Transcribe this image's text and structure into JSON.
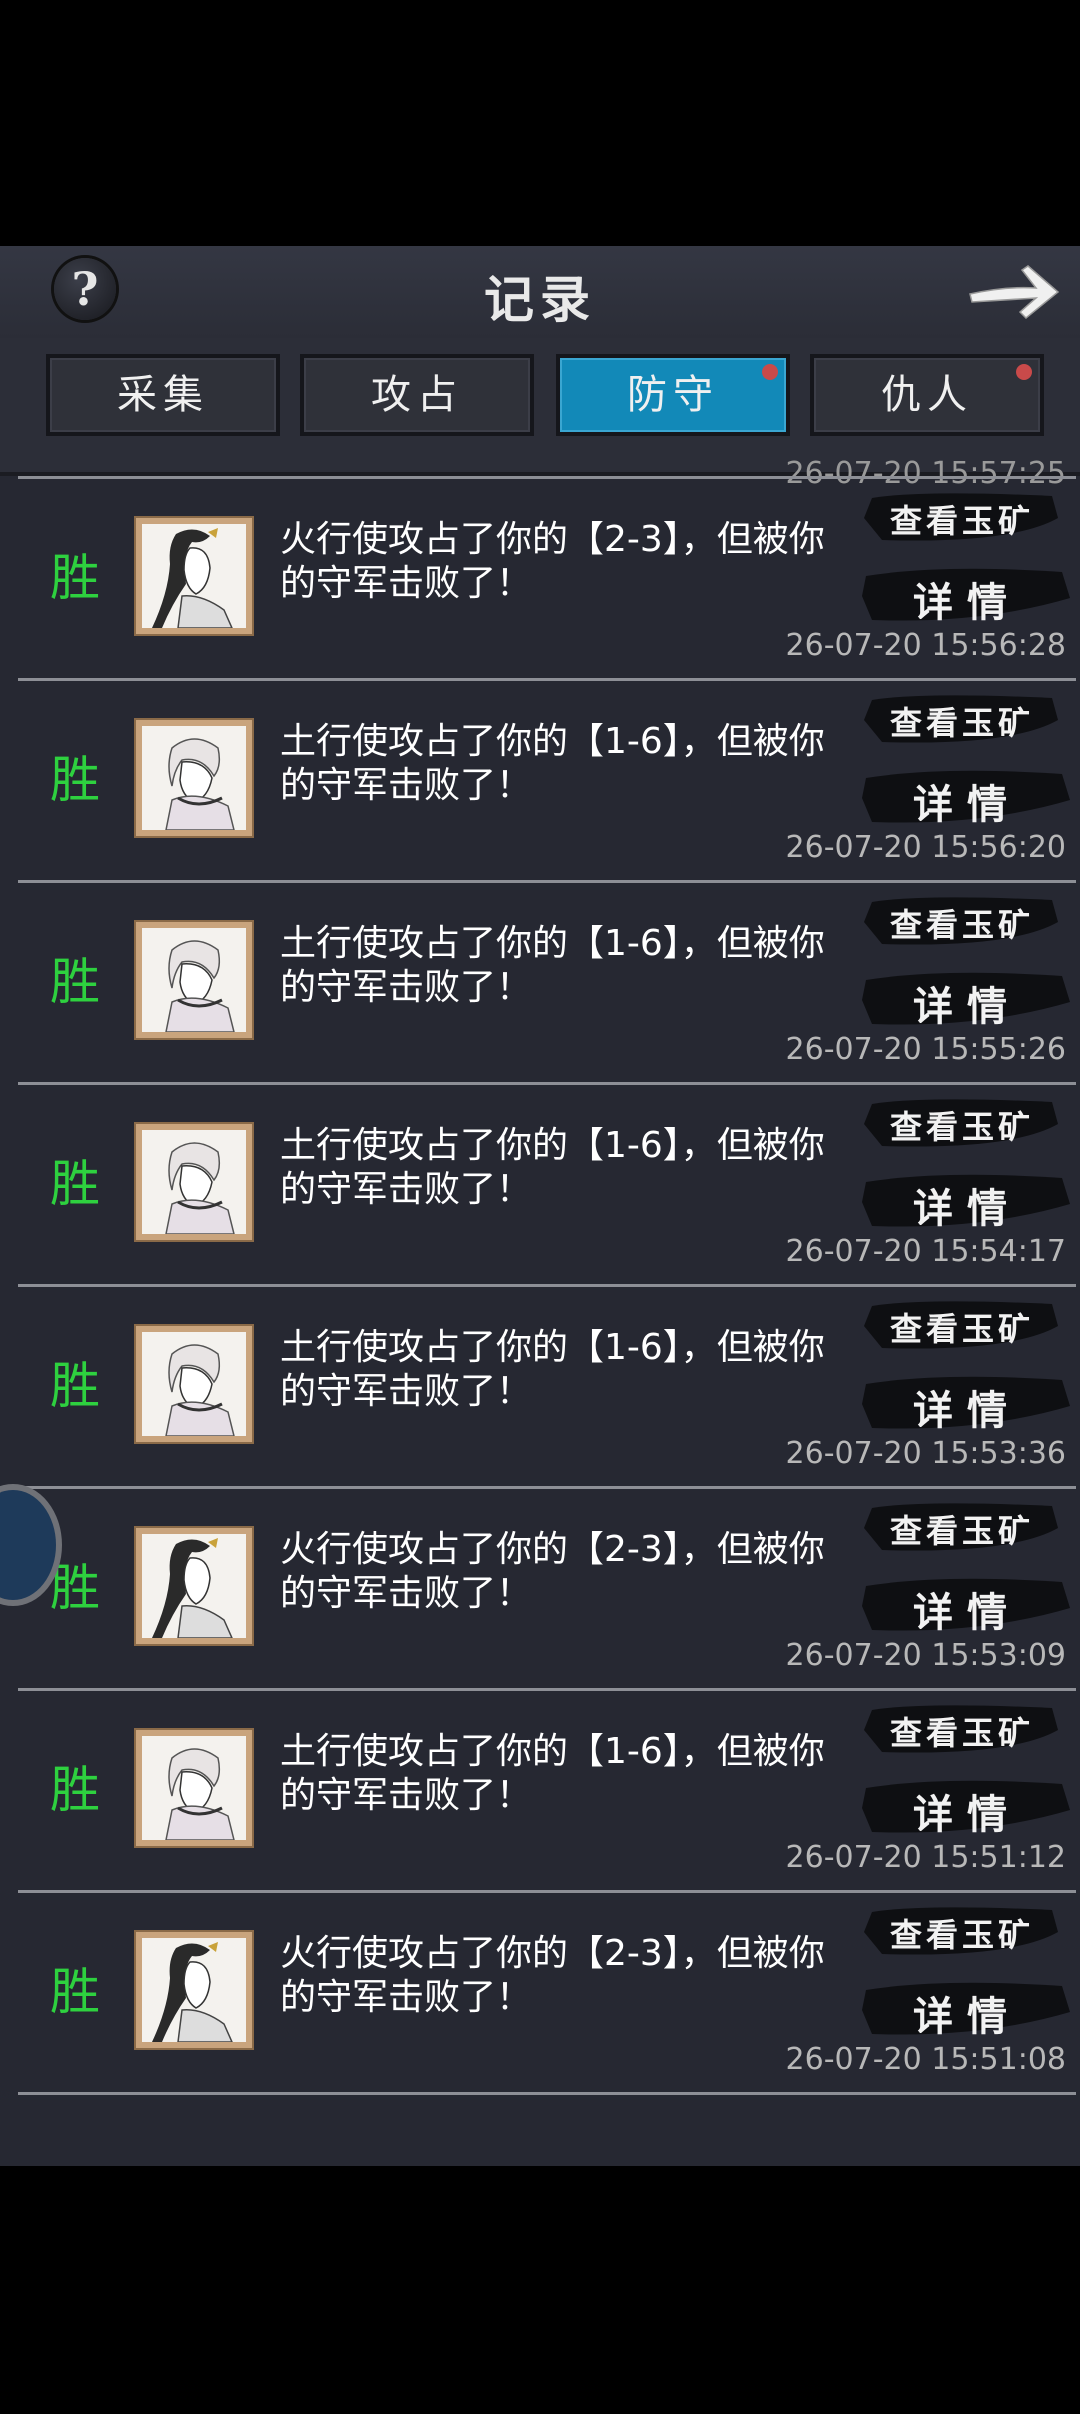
{
  "header": {
    "title": "记录",
    "help_label": "?",
    "back_icon": "arrow-right-icon"
  },
  "tabs": [
    {
      "label": "采集",
      "active": false,
      "dot": false
    },
    {
      "label": "攻占",
      "active": false,
      "dot": false
    },
    {
      "label": "防守",
      "active": true,
      "dot": true
    },
    {
      "label": "仇人",
      "active": false,
      "dot": true
    }
  ],
  "clipped_time": "26-07-20 15:57:25",
  "records": [
    {
      "result": "胜",
      "avatar": "fire-envoy-avatar",
      "message": "火行使攻占了你的【2-3】，但被你的守军击败了！",
      "view_mine": "查看玉矿",
      "detail": "详情",
      "time": "26-07-20 15:56:28"
    },
    {
      "result": "胜",
      "avatar": "earth-envoy-avatar",
      "message": "土行使攻占了你的【1-6】，但被你的守军击败了！",
      "view_mine": "查看玉矿",
      "detail": "详情",
      "time": "26-07-20 15:56:20"
    },
    {
      "result": "胜",
      "avatar": "earth-envoy-avatar",
      "message": "土行使攻占了你的【1-6】，但被你的守军击败了！",
      "view_mine": "查看玉矿",
      "detail": "详情",
      "time": "26-07-20 15:55:26"
    },
    {
      "result": "胜",
      "avatar": "earth-envoy-avatar",
      "message": "土行使攻占了你的【1-6】，但被你的守军击败了！",
      "view_mine": "查看玉矿",
      "detail": "详情",
      "time": "26-07-20 15:54:17"
    },
    {
      "result": "胜",
      "avatar": "earth-envoy-avatar",
      "message": "土行使攻占了你的【1-6】，但被你的守军击败了！",
      "view_mine": "查看玉矿",
      "detail": "详情",
      "time": "26-07-20 15:53:36"
    },
    {
      "result": "胜",
      "avatar": "fire-envoy-avatar",
      "message": "火行使攻占了你的【2-3】，但被你的守军击败了！",
      "view_mine": "查看玉矿",
      "detail": "详情",
      "time": "26-07-20 15:53:09"
    },
    {
      "result": "胜",
      "avatar": "earth-envoy-avatar",
      "message": "土行使攻占了你的【1-6】，但被你的守军击败了！",
      "view_mine": "查看玉矿",
      "detail": "详情",
      "time": "26-07-20 15:51:12"
    },
    {
      "result": "胜",
      "avatar": "fire-envoy-avatar",
      "message": "火行使攻占了你的【2-3】，但被你的守军击败了！",
      "view_mine": "查看玉矿",
      "detail": "详情",
      "time": "26-07-20 15:51:08"
    }
  ],
  "colors": {
    "win": "#2ed13f",
    "active_tab": "#1289b8",
    "panel_bg": "#262832",
    "tab_dot": "#c94a4a"
  }
}
